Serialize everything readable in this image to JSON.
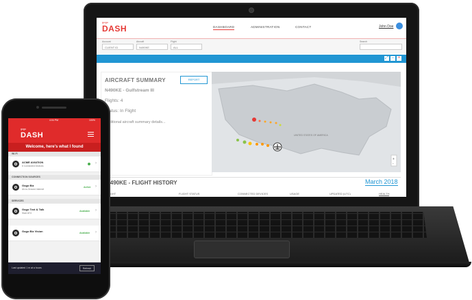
{
  "laptop": {
    "app_logo": "DASH",
    "app_logo_tag": "gogo",
    "nav": [
      "DASHBOARD",
      "ADMINISTRATION",
      "CONTACT"
    ],
    "user": "John Doe",
    "filters": [
      {
        "label": "Account",
        "value": "CLIENT ID"
      },
      {
        "label": "Aircraft",
        "value": "N490KE"
      },
      {
        "label": "Flight",
        "value": "ALL"
      }
    ],
    "search_label": "Search",
    "summary": {
      "title": "AIRCRAFT SUMMARY",
      "report_button": "REPORT",
      "tail": "N490KE - Gulfstream III",
      "flights": "Flights: 4",
      "status": "Status: In Flight",
      "more": "Additional aircraft summary details..."
    },
    "map_label": "UNITED STATES OF AMERICA",
    "history": {
      "title": "N490KE - FLIGHT HISTORY",
      "month": "March 2018",
      "columns": [
        "FLIGHT",
        "FLIGHT STATUS",
        "CONNECTED DEVICES",
        "USAGE",
        "UPDATED (UTC)",
        "HEALTH"
      ]
    },
    "colors": {
      "accent": "#e53935",
      "blue": "#2196d3"
    }
  },
  "phone": {
    "time": "4:04 PM",
    "battery": "100%",
    "app_logo": "DASH",
    "app_logo_tag": "gogo",
    "welcome": "Welcome, here's what I found",
    "sections": [
      {
        "title": "WI-FI",
        "rows": [
          {
            "title": "ACME AVIATION",
            "sub": "6 Connected Devices",
            "badge": ""
          }
        ]
      },
      {
        "title": "CONNECTION SOURCES",
        "rows": [
          {
            "title": "Gogo Biz",
            "sub": "Air-to-Ground Internet",
            "badge": "Active"
          }
        ]
      },
      {
        "title": "SERVICES",
        "rows": [
          {
            "title": "Gogo Text & Talk",
            "sub": "Start ATG",
            "badge": "Available"
          },
          {
            "title": "Gogo Biz Vision",
            "sub": "",
            "badge": "Available"
          }
        ]
      }
    ],
    "footer": "Last updated 1 m at a hours",
    "refresh": "Refresh"
  }
}
